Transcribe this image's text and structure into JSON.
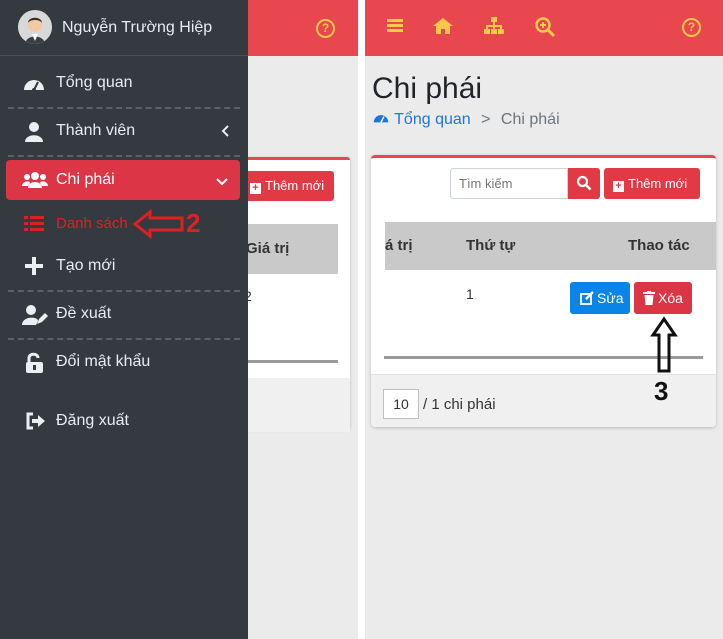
{
  "left_panel": {
    "add_label": "Thêm mới",
    "header_col": "Giá trị",
    "cell_value": "2"
  },
  "sidebar": {
    "user_name": "Nguyễn Trường Hiệp",
    "items": [
      {
        "label": "Tổng quan",
        "icon": "dashboard-icon"
      },
      {
        "label": "Thành viên",
        "icon": "user-icon"
      },
      {
        "label": "Chi phái",
        "icon": "users-icon",
        "active": true
      },
      {
        "label": "Danh sách",
        "icon": "list-icon"
      },
      {
        "label": "Tạo mới",
        "icon": "plus-icon"
      },
      {
        "label": "Đề xuất",
        "icon": "user-edit-icon"
      },
      {
        "label": "Đổi mật khẩu",
        "icon": "unlock-icon"
      },
      {
        "label": "Đăng xuất",
        "icon": "sign-out-icon"
      }
    ],
    "active_color": "#dc3545"
  },
  "page": {
    "title": "Chi phái",
    "breadcrumb": {
      "home": "Tổng quan",
      "separator": ">",
      "current": "Chi phái"
    }
  },
  "toolbar": {
    "search_placeholder": "Tìm kiếm",
    "add_label": "Thêm mới"
  },
  "table": {
    "columns": [
      "á trị",
      "Thứ tự",
      "Thao tác"
    ],
    "rows": [
      {
        "order": "1",
        "edit_label": "Sửa",
        "delete_label": "Xóa"
      }
    ]
  },
  "pagination": {
    "page_size": "10",
    "total_text": "/ 1 chi phái"
  },
  "annotations": {
    "step2": "2",
    "step3": "3"
  },
  "colors": {
    "topbar": "#e8474f",
    "sidebar_bg": "#343a40",
    "primary": "#0a84e6",
    "danger": "#dc3545",
    "icon_yellow": "#f7c84a"
  }
}
